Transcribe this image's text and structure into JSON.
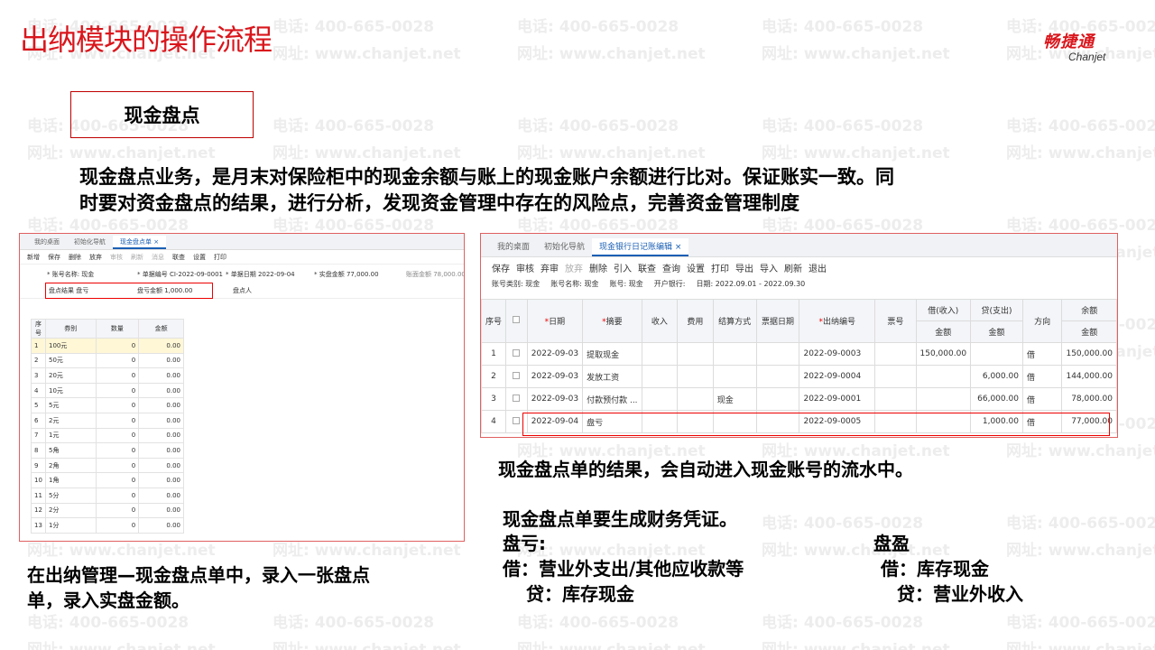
{
  "title": "出纳模块的操作流程",
  "logo": {
    "cn": "畅捷通",
    "en": "Chanjet"
  },
  "watermark": {
    "phone": "电话: 400-665-0028",
    "site": "网址: www.chanjet.net"
  },
  "section": {
    "label": "现金盘点"
  },
  "description": {
    "line1": "现金盘点业务，是月末对保险柜中的现金余额与账上的现金账户余额进行比对。保证账实一致。同",
    "line2": "时要对资金盘点的结果，进行分析，发现资金管理中存在的风险点，完善资金管理制度"
  },
  "left_screen": {
    "tabs": [
      "我的桌面",
      "初始化导航",
      "现金盘点单"
    ],
    "close": "×",
    "toolbar": [
      "新增",
      "保存",
      "删除",
      "放弃",
      "审核",
      "刷新",
      "消息",
      "联查",
      "设置",
      "打印"
    ],
    "form": {
      "account": "* 账号名称: 现金",
      "doc_no": "* 单据编号 CI-2022-09-0001",
      "doc_date": "* 单据日期 2022-09-04",
      "actual_amount": "* 实盘金额 77,000.00",
      "book_balance": "账面金额 78,000.00",
      "result": "盘点结果 盘亏",
      "diff": "盘亏金额 1,000.00",
      "counter": "盘点人"
    },
    "table": {
      "headers": [
        "序号",
        "券别",
        "数量",
        "金额"
      ],
      "rows": [
        [
          "1",
          "100元",
          "0",
          "0.00"
        ],
        [
          "2",
          "50元",
          "0",
          "0.00"
        ],
        [
          "3",
          "20元",
          "0",
          "0.00"
        ],
        [
          "4",
          "10元",
          "0",
          "0.00"
        ],
        [
          "5",
          "5元",
          "0",
          "0.00"
        ],
        [
          "6",
          "2元",
          "0",
          "0.00"
        ],
        [
          "7",
          "1元",
          "0",
          "0.00"
        ],
        [
          "8",
          "5角",
          "0",
          "0.00"
        ],
        [
          "9",
          "2角",
          "0",
          "0.00"
        ],
        [
          "10",
          "1角",
          "0",
          "0.00"
        ],
        [
          "11",
          "5分",
          "0",
          "0.00"
        ],
        [
          "12",
          "2分",
          "0",
          "0.00"
        ],
        [
          "13",
          "1分",
          "0",
          "0.00"
        ]
      ]
    }
  },
  "right_screen": {
    "tabs": [
      "我的桌面",
      "初始化导航",
      "现金银行日记账编辑"
    ],
    "close": "×",
    "toolbar": [
      "保存",
      "审核",
      "弃审",
      "放弃",
      "删除",
      "引入",
      "联查",
      "查询",
      "设置",
      "打印",
      "导出",
      "导入",
      "刷新",
      "退出"
    ],
    "info": {
      "account_type": "账号类别: 现金",
      "account_name": "账号名称: 现金",
      "account_no": "账号: 现金",
      "bank": "开户银行:",
      "date_range": "日期: 2022.09.01 - 2022.09.30"
    },
    "table": {
      "headers": [
        "序号",
        "",
        "日期",
        "摘要",
        "收入",
        "费用",
        "结算方式",
        "票据日期",
        "出纳编号",
        "票号",
        "借(收入)",
        "贷(支出)",
        "方向",
        "余额"
      ],
      "sub_header": "金额",
      "rows": [
        [
          "1",
          "2022-09-03",
          "提取现金",
          "",
          "",
          "",
          "",
          "2022-09-0003",
          "",
          "150,000.00",
          "",
          "借",
          "150,000.00"
        ],
        [
          "2",
          "2022-09-03",
          "发放工资",
          "",
          "",
          "",
          "",
          "2022-09-0004",
          "",
          "",
          "6,000.00",
          "借",
          "144,000.00"
        ],
        [
          "3",
          "2022-09-03",
          "付款预付款 ...",
          "",
          "",
          "现金",
          "",
          "2022-09-0001",
          "",
          "",
          "66,000.00",
          "借",
          "78,000.00"
        ],
        [
          "4",
          "2022-09-04",
          "盘亏",
          "",
          "",
          "",
          "",
          "2022-09-0005",
          "",
          "",
          "1,000.00",
          "借",
          "77,000.00"
        ]
      ]
    }
  },
  "notes": {
    "left": [
      "在出纳管理—现金盘点单中，录入一张盘点",
      "单，录入实盘金额。"
    ],
    "right_result": "现金盘点单的结果，会自动进入现金账号的流水中。",
    "voucher_title": "现金盘点单要生成财务凭证。",
    "loss": {
      "title": "盘亏:",
      "debit": "借：营业外支出/其他应收款等",
      "credit": "贷：库存现金"
    },
    "gain": {
      "title": "盘盈",
      "debit": "借：库存现金",
      "credit": "贷：营业外收入"
    }
  }
}
